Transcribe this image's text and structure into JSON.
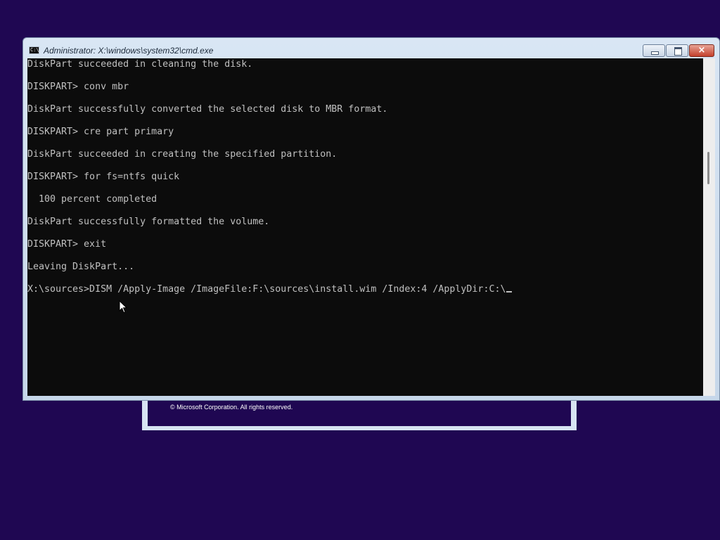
{
  "setup_window": {
    "copyright": "© Microsoft Corporation. All rights reserved."
  },
  "cmd_window": {
    "title": "Administrator: X:\\windows\\system32\\cmd.exe",
    "icon_label": "C:\\",
    "icon": "cmd-icon",
    "buttons": {
      "minimize": "minimize-icon",
      "maximize": "restore-icon",
      "close": "×"
    }
  },
  "console": {
    "lines": [
      "DiskPart succeeded in cleaning the disk.",
      "",
      "DISKPART> conv mbr",
      "",
      "DiskPart successfully converted the selected disk to MBR format.",
      "",
      "DISKPART> cre part primary",
      "",
      "DiskPart succeeded in creating the specified partition.",
      "",
      "DISKPART> for fs=ntfs quick",
      "",
      "  100 percent completed",
      "",
      "DiskPart successfully formatted the volume.",
      "",
      "DISKPART> exit",
      "",
      "Leaving DiskPart...",
      "",
      "X:\\sources>DISM /Apply-Image /ImageFile:F:\\sources\\install.wim /Index:4 /ApplyDir:C:\\"
    ]
  },
  "colors": {
    "desktop_background": "#1f0752",
    "console_background": "#0c0c0c",
    "console_text": "#c0c0c0"
  }
}
